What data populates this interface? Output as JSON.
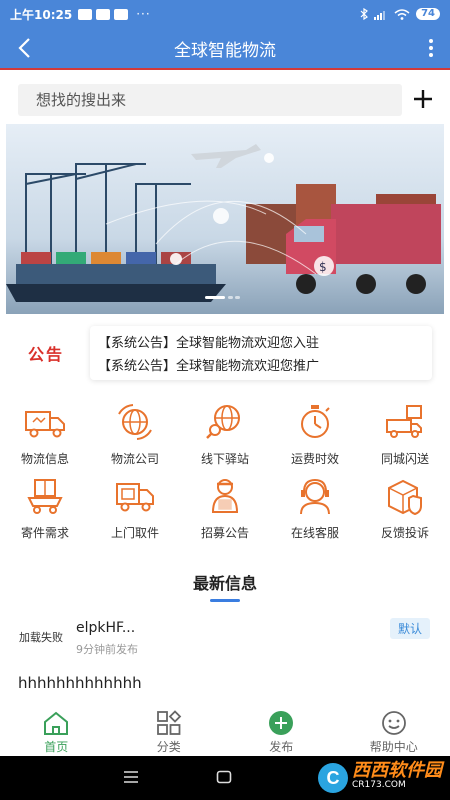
{
  "status_bar": {
    "time": "上午10:25",
    "extra": "···",
    "battery": "74"
  },
  "header": {
    "title": "全球智能物流"
  },
  "search": {
    "placeholder": "想找的搜出来"
  },
  "notice": {
    "label": "公告",
    "lines": [
      "【系统公告】全球智能物流欢迎您入驻",
      "【系统公告】全球智能物流欢迎您推广"
    ]
  },
  "grid": [
    {
      "label": "物流信息",
      "icon": "truck-icon"
    },
    {
      "label": "物流公司",
      "icon": "globe-arrows-icon"
    },
    {
      "label": "线下驿站",
      "icon": "globe-search-icon"
    },
    {
      "label": "运费时效",
      "icon": "stopwatch-icon"
    },
    {
      "label": "同城闪送",
      "icon": "delivery-van-icon"
    },
    {
      "label": "寄件需求",
      "icon": "cart-box-icon"
    },
    {
      "label": "上门取件",
      "icon": "pickup-truck-icon"
    },
    {
      "label": "招募公告",
      "icon": "courier-icon"
    },
    {
      "label": "在线客服",
      "icon": "support-agent-icon"
    },
    {
      "label": "反馈投诉",
      "icon": "package-shield-icon"
    }
  ],
  "latest": {
    "title": "最新信息",
    "post": {
      "thumb_text": "加载失败",
      "name": "elpkHF...",
      "time": "9分钟前发布",
      "tag": "默认",
      "body": "hhhhhhhhhhhhh"
    }
  },
  "tabbar": [
    {
      "label": "首页",
      "icon": "home-icon",
      "active": true
    },
    {
      "label": "分类",
      "icon": "category-icon",
      "active": false
    },
    {
      "label": "发布",
      "icon": "add-circle-icon",
      "active": false
    },
    {
      "label": "帮助中心",
      "icon": "smile-icon",
      "active": false
    }
  ],
  "watermark": {
    "text": "西西软件园",
    "sub": "CR173.COM"
  },
  "colors": {
    "primary": "#4a86d8",
    "accent": "#e8732d",
    "notice_red": "#d9302a",
    "active_green": "#3aa05a"
  }
}
